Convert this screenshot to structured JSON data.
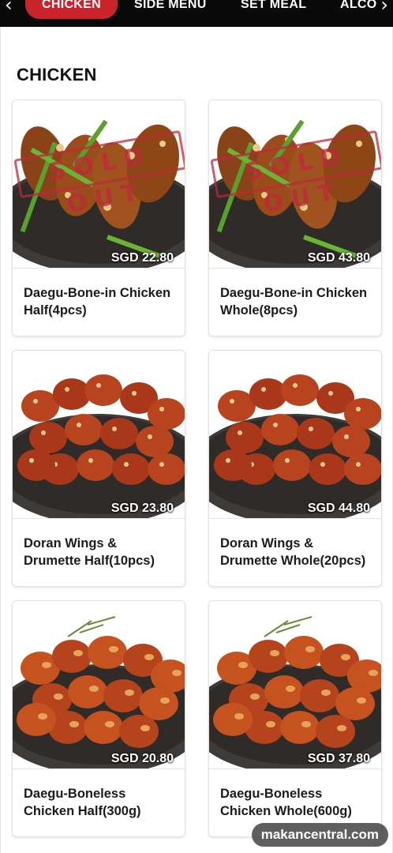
{
  "nav": {
    "tabs": [
      "CHICKEN",
      "SIDE MENU",
      "SET MEAL",
      "ALCO"
    ],
    "active_tab": "CHICKEN",
    "prev_icon": "chevron-left-icon",
    "next_icon": "chevron-right-icon"
  },
  "section": {
    "title": "CHICKEN"
  },
  "products": [
    {
      "name": "Daegu-Bone-in Chicken Half(4pcs)",
      "price": "SGD 22.80",
      "sold_out": true,
      "sold_out_label": "SOLD OUT",
      "style": "wings"
    },
    {
      "name": "Daegu-Bone-in Chicken Whole(8pcs)",
      "price": "SGD 43.80",
      "sold_out": true,
      "sold_out_label": "SOLD OUT",
      "style": "wings"
    },
    {
      "name": "Doran Wings & Drumette Half(10pcs)",
      "price": "SGD 23.80",
      "sold_out": false,
      "style": "glazed"
    },
    {
      "name": "Doran Wings & Drumette Whole(20pcs)",
      "price": "SGD 44.80",
      "sold_out": false,
      "style": "glazed"
    },
    {
      "name": "Daegu-Boneless Chicken Half(300g)",
      "price": "SGD 20.80",
      "sold_out": false,
      "style": "boneless"
    },
    {
      "name": "Daegu-Boneless Chicken Whole(600g)",
      "price": "SGD 37.80",
      "sold_out": false,
      "style": "boneless"
    }
  ],
  "colors": {
    "accent": "#c8242b",
    "nav_bg": "#0a0a0a",
    "sold_out_stamp": "#be283c"
  },
  "watermark": "makancentral.com"
}
